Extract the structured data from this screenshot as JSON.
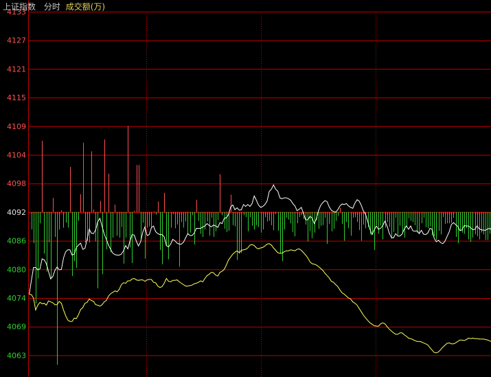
{
  "header": {
    "index_name": "上证指数",
    "view_mode": "分时",
    "metric": "成交额(万)"
  },
  "colors": {
    "background": "#000000",
    "grid": "#c00000",
    "up_text": "#ff5050",
    "down_text": "#30d030",
    "neutral_text": "#e0e0e0",
    "price_line": "#ffffff",
    "avg_line": "#ffff60",
    "bar_up": "#ff5050",
    "bar_down": "#30d030"
  },
  "chart_data": {
    "type": "line",
    "reference_value": 4092,
    "yticks": [
      "4133",
      "4127",
      "4121",
      "4115",
      "4109",
      "4104",
      "4098",
      "4092",
      "4086",
      "4080",
      "4074",
      "4069",
      "4063"
    ],
    "ylim": [
      4060,
      4133
    ],
    "x_count": 216,
    "series": [
      {
        "kind": "price",
        "values": [
          4074.8,
          4077.7,
          4080.4,
          4080.4,
          4079.9,
          4080.1,
          4082.2,
          4082.0,
          4081.2,
          4079.6,
          4078.0,
          4078.5,
          4079.8,
          4080.5,
          4079.9,
          4080.0,
          4082.4,
          4083.7,
          4084.1,
          4084.1,
          4083.0,
          4083.2,
          4084.6,
          4085.1,
          4085.5,
          4084.2,
          4084.4,
          4086.3,
          4088.4,
          4087.6,
          4087.5,
          4088.3,
          4090.0,
          4090.7,
          4089.0,
          4087.4,
          4086.3,
          4085.1,
          4084.2,
          4083.4,
          4083.1,
          4083.0,
          4083.0,
          4083.2,
          4083.9,
          4085.0,
          4084.3,
          4085.9,
          4087.3,
          4087.2,
          4085.9,
          4084.9,
          4085.8,
          4087.8,
          4088.9,
          4087.1,
          4087.3,
          4088.7,
          4089.1,
          4087.9,
          4087.5,
          4087.3,
          4087.3,
          4086.8,
          4085.0,
          4084.7,
          4085.3,
          4086.3,
          4086.0,
          4085.5,
          4085.3,
          4085.3,
          4085.7,
          4086.6,
          4087.5,
          4087.1,
          4087.1,
          4087.6,
          4088.6,
          4088.6,
          4088.6,
          4088.9,
          4089.1,
          4089.6,
          4089.2,
          4088.9,
          4089.3,
          4089.1,
          4088.8,
          4089.8,
          4089.6,
          4090.7,
          4090.8,
          4091.5,
          4093.1,
          4093.5,
          4092.5,
          4092.9,
          4092.4,
          4092.5,
          4093.6,
          4093.2,
          4093.6,
          4093.2,
          4093.8,
          4095.4,
          4094.5,
          4093.5,
          4093.0,
          4093.2,
          4093.6,
          4094.3,
          4096.3,
          4096.8,
          4097.7,
          4096.8,
          4096.4,
          4095.0,
          4094.8,
          4095.0,
          4095.0,
          4094.8,
          4094.5,
          4093.8,
          4093.3,
          4092.3,
          4092.6,
          4093.0,
          4091.7,
          4090.4,
          4090.4,
          4091.1,
          4090.8,
          4089.6,
          4090.6,
          4092.3,
          4093.4,
          4094.0,
          4094.4,
          4094.2,
          4093.1,
          4092.4,
          4092.1,
          4092.0,
          4092.5,
          4093.3,
          4093.7,
          4093.6,
          4093.8,
          4093.3,
          4093.0,
          4092.8,
          4093.9,
          4094.6,
          4094.3,
          4093.4,
          4092.2,
          4091.5,
          4090.0,
          4088.4,
          4087.3,
          4088.3,
          4089.1,
          4088.4,
          4088.6,
          4089.2,
          4090.1,
          4089.1,
          4087.6,
          4086.7,
          4086.6,
          4087.5,
          4087.0,
          4087.0,
          4087.4,
          4088.4,
          4089.1,
          4088.4,
          4089.1,
          4088.1,
          4088.0,
          4088.1,
          4087.5,
          4088.2,
          4087.4,
          4087.3,
          4087.6,
          4088.6,
          4088.4,
          4086.5,
          4085.8,
          4086.1,
          4085.6,
          4085.4,
          4085.9,
          4086.9,
          4087.9,
          4089.4,
          4089.8,
          4089.4,
          4089.0,
          4088.1,
          4088.3,
          4089.2,
          4089.1,
          4089.1,
          4088.7,
          4088.3,
          4088.4,
          4089.1,
          4088.5,
          4088.3,
          4088.2,
          4088.2,
          4088.5,
          4088.6,
          4088.2,
          4087.1
        ]
      },
      {
        "kind": "average",
        "values": [
          4074.8,
          4074.7,
          4074.0,
          4071.5,
          4072.5,
          4073.1,
          4072.8,
          4072.9,
          4072.5,
          4073.4,
          4073.2,
          4073.0,
          4072.6,
          4072.6,
          4073.3,
          4072.9,
          4071.5,
          4070.3,
          4069.4,
          4069.1,
          4069.1,
          4069.8,
          4069.7,
          4070.5,
          4071.6,
          4072.0,
          4072.9,
          4073.1,
          4073.8,
          4073.5,
          4073.3,
          4072.6,
          4072.5,
          4072.3,
          4072.6,
          4073.2,
          4073.5,
          4074.4,
          4074.9,
          4075.2,
          4075.5,
          4075.3,
          4075.8,
          4076.8,
          4077.2,
          4077.1,
          4077.6,
          4077.6,
          4078.0,
          4078.1,
          4077.8,
          4077.7,
          4077.8,
          4077.8,
          4077.5,
          4077.8,
          4077.9,
          4077.9,
          4077.3,
          4077.2,
          4076.5,
          4076.2,
          4076.4,
          4077.1,
          4078.1,
          4077.5,
          4077.4,
          4077.7,
          4077.7,
          4077.8,
          4077.4,
          4077.1,
          4076.8,
          4076.5,
          4076.5,
          4076.6,
          4076.7,
          4077.0,
          4077.1,
          4077.3,
          4077.6,
          4077.4,
          4078.1,
          4078.7,
          4079.0,
          4079.4,
          4079.3,
          4078.8,
          4078.6,
          4079.4,
          4079.6,
          4080.0,
          4080.9,
          4082.0,
          4082.6,
          4083.2,
          4083.6,
          4083.9,
          4083.5,
          4084.0,
          4084.1,
          4084.2,
          4084.5,
          4085.1,
          4085.2,
          4085.0,
          4084.5,
          4084.3,
          4084.5,
          4084.6,
          4084.9,
          4085.3,
          4085.4,
          4085.1,
          4084.5,
          4084.0,
          4083.5,
          4083.4,
          4083.4,
          4083.7,
          4083.9,
          4083.9,
          4084.1,
          4084.0,
          4083.9,
          4084.2,
          4084.3,
          4084.0,
          4083.5,
          4083.0,
          4082.4,
          4081.6,
          4081.2,
          4081.1,
          4080.9,
          4080.6,
          4080.2,
          4079.8,
          4079.2,
          4078.7,
          4078.2,
          4077.5,
          4077.3,
          4076.8,
          4076.4,
          4075.7,
          4075.1,
          4074.8,
          4074.4,
          4074.0,
          4073.8,
          4073.2,
          4072.9,
          4072.5,
          4071.8,
          4071.1,
          4070.4,
          4069.8,
          4069.3,
          4068.8,
          4068.5,
          4068.2,
          4068.1,
          4068.1,
          4068.6,
          4068.8,
          4068.6,
          4068.0,
          4067.5,
          4067.1,
          4066.7,
          4066.4,
          4066.4,
          4066.7,
          4066.7,
          4066.3,
          4066.0,
          4065.6,
          4065.5,
          4065.3,
          4065.1,
          4064.9,
          4064.9,
          4064.8,
          4064.6,
          4064.4,
          4064.2,
          4063.6,
          4063.1,
          4062.6,
          4062.5,
          4062.7,
          4063.2,
          4063.7,
          4064.1,
          4064.5,
          4064.6,
          4064.4,
          4064.4,
          4064.6,
          4064.9,
          4065.2,
          4065.2,
          4065.1,
          4065.3,
          4065.6,
          4065.5,
          4065.6,
          4065.5,
          4065.5,
          4065.4,
          4065.4,
          4065.4,
          4065.3,
          4065.2,
          4065.0,
          4064.8,
          4064.7,
          4064.6,
          4064.5,
          4064.2,
          4064.3
        ]
      },
      {
        "kind": "turnover",
        "bars": [
          0,
          -0.28,
          -0.5,
          -1.47,
          -1.07,
          -0.18,
          1.15,
          -0.67,
          -0.96,
          -0.49,
          -1.06,
          0.23,
          -0.4,
          -2.46,
          -0.28,
          0.03,
          -0.25,
          -0.17,
          -0.25,
          0.73,
          -1.03,
          -0.79,
          -0.9,
          -0.14,
          0.29,
          1.12,
          -0.49,
          -0.46,
          -0.49,
          0.98,
          0.04,
          -0.47,
          -1.23,
          0.18,
          -1.0,
          1.17,
          -0.6,
          0.62,
          -0.65,
          -0.41,
          0.12,
          -0.38,
          -0.41,
          -0.24,
          -0.83,
          -0.41,
          1.39,
          -0.57,
          -0.82,
          0.02,
          0.76,
          0.76,
          -0.45,
          -0.17,
          -0.75,
          -0.25,
          -0.23,
          -0.25,
          0.01,
          -0.04,
          0.17,
          -0.61,
          -0.84,
          0.31,
          -0.55,
          -0.76,
          -0.25,
          -0.03,
          -0.26,
          -0.2,
          -0.88,
          -0.16,
          -0.25,
          -0.15,
          -0.36,
          -0.33,
          -0.05,
          -0.52,
          0.2,
          -0.14,
          -0.35,
          -0.4,
          -0.28,
          -0.15,
          -0.38,
          -0.09,
          -0.4,
          -0.31,
          -0.13,
          0.61,
          -0.05,
          -0.27,
          -0.32,
          -0.3,
          0.28,
          -0.21,
          -0.23,
          -0.77,
          -0.67,
          -0.66,
          -0.05,
          -0.08,
          -0.31,
          -0.08,
          -0.22,
          -0.28,
          -0.21,
          -0.24,
          -0.33,
          -0.28,
          -0.08,
          -0.15,
          -0.14,
          -0.21,
          -0.29,
          -0.03,
          -0.3,
          -0.66,
          -0.79,
          -0.28,
          -0.09,
          -0.12,
          -0.18,
          -0.32,
          -0.39,
          -0.18,
          -0.08,
          -0.05,
          -0.11,
          -0.2,
          -0.47,
          -0.31,
          -0.42,
          -0.33,
          -0.13,
          -0.27,
          -0.22,
          -0.21,
          -0.09,
          -0.51,
          -0.19,
          -0.31,
          -0.27,
          -0.14,
          -0.06,
          0.07,
          -0.19,
          -0.46,
          -0.16,
          -0.26,
          -0.38,
          -0.09,
          -0.08,
          -0.16,
          -0.29,
          -0.46,
          -0.2,
          -0.26,
          -0.24,
          -0.36,
          -0.36,
          -0.61,
          -0.21,
          -0.35,
          -0.22,
          -0.44,
          -0.25,
          -0.16,
          -0.24,
          -0.43,
          -0.32,
          -0.09,
          -0.37,
          -0.22,
          -0.33,
          -0.41,
          -0.24,
          -0.1,
          -0.14,
          -0.16,
          -0.21,
          -0.33,
          -0.35,
          -0.18,
          -0.09,
          -0.24,
          -0.26,
          -0.23,
          -0.38,
          -0.39,
          -0.45,
          -0.3,
          -0.36,
          -0.08,
          -0.19,
          -0.18,
          -0.18,
          -0.17,
          -0.09,
          -0.4,
          -0.5,
          -0.3,
          -0.33,
          -0.35,
          -0.26,
          -0.44,
          -0.48,
          -0.41,
          -0.36,
          -0.39,
          -0.44,
          -0.33,
          -0.36,
          -0.45,
          -0.45,
          -0.35,
          -0.25,
          -0.11
        ]
      }
    ],
    "grid": true
  }
}
